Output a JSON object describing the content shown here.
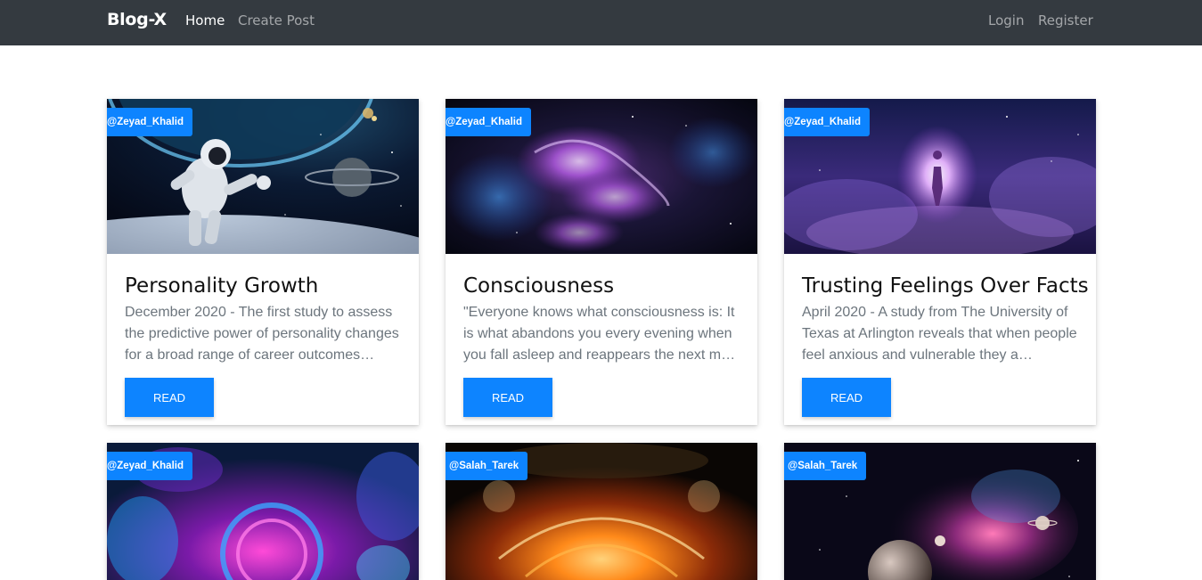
{
  "navbar": {
    "brand": "Blog-X",
    "links": [
      {
        "label": "Home",
        "active": true
      },
      {
        "label": "Create Post",
        "active": false
      }
    ],
    "auth": [
      {
        "label": "Login"
      },
      {
        "label": "Register"
      }
    ]
  },
  "posts": [
    {
      "author": "@Zeyad_Khalid",
      "title": "Personality Growth",
      "excerpt": "December 2020 - The first study to assess the predictive power of personality changes for a broad range of career outcomes…",
      "button": "READ"
    },
    {
      "author": "@Zeyad_Khalid",
      "title": "Consciousness",
      "excerpt": "\"Everyone knows what consciousness is: It is what abandons you every evening when you fall asleep and reappears the next m…",
      "button": "READ"
    },
    {
      "author": "@Zeyad_Khalid",
      "title": "Trusting Feelings Over Facts",
      "excerpt": "April 2020 - A study from The University of Texas at Arlington reveals that when people feel anxious and vulnerable they a…",
      "button": "READ"
    },
    {
      "author": "@Zeyad_Khalid"
    },
    {
      "author": "@Salah_Tarek"
    },
    {
      "author": "@Salah_Tarek"
    }
  ]
}
